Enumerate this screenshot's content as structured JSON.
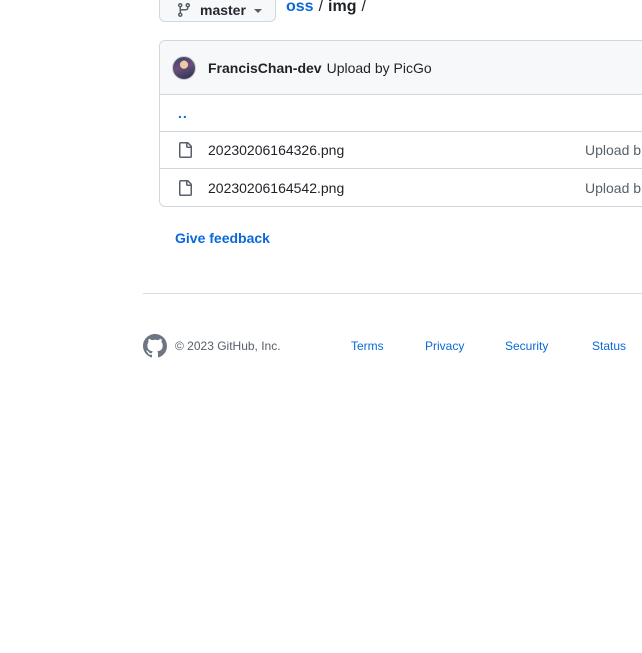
{
  "repo_nav": {
    "branch": "master",
    "breadcrumb": {
      "root": "oss",
      "separator": "/",
      "current": "img",
      "trailing_separator": "/"
    }
  },
  "latest_commit": {
    "author": "FrancisChan-dev",
    "message": "Upload by PicGo"
  },
  "file_list": {
    "parent_dir": "..",
    "files": [
      {
        "name": "20230206164326.png",
        "commit_message": "Upload b",
        "icon": "file-icon"
      },
      {
        "name": "20230206164542.png",
        "commit_message": "Upload b",
        "icon": "file-icon"
      }
    ]
  },
  "feedback_label": "Give feedback",
  "footer": {
    "copyright": "© 2023 GitHub, Inc.",
    "links": [
      "Terms",
      "Privacy",
      "Security",
      "Status"
    ]
  },
  "colors": {
    "link": "#0969da",
    "border": "#d0d7de",
    "header_bg": "#f6f8fa",
    "muted_text": "#57606a"
  }
}
